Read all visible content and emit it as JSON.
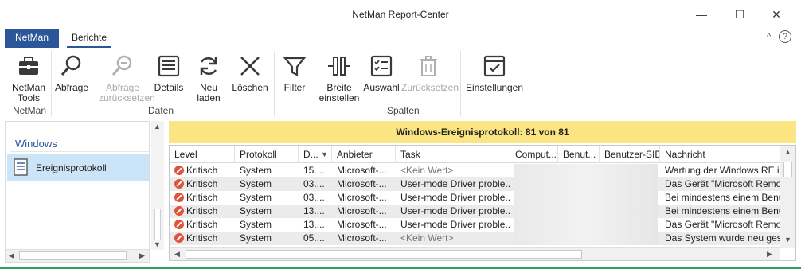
{
  "window": {
    "title": "NetMan Report-Center",
    "minimize": "—",
    "maximize": "☐",
    "close": "✕"
  },
  "tabs": {
    "netman": "NetMan",
    "berichte": "Berichte",
    "collapse": "^",
    "help": "?"
  },
  "ribbon": {
    "netman_tools": "NetMan Tools",
    "abfrage": "Abfrage",
    "abfrage_reset": "Abfrage zurücksetzen",
    "details": "Details",
    "neu_laden": "Neu laden",
    "loeschen": "Löschen",
    "filter": "Filter",
    "breite": "Breite einstellen",
    "auswahl": "Auswahl",
    "zuruecksetzen": "Zurücksetzen",
    "einstellungen": "Einstellungen",
    "groups": {
      "netman": "NetMan",
      "daten": "Daten",
      "spalten": "Spalten"
    }
  },
  "tree": {
    "header": "Windows",
    "item": "Ereignisprotokoll"
  },
  "banner": "Windows-Ereignisprotokoll: 81 von 81",
  "table": {
    "columns": [
      "Level",
      "Protokoll",
      "D...",
      "Anbieter",
      "Task",
      "Comput...",
      "Benut...",
      "Benutzer-SID",
      "Nachricht"
    ],
    "rows": [
      {
        "level": "Kritisch",
        "protokoll": "System",
        "datum": "15....",
        "anbieter": "Microsoft-...",
        "task": "<Kein Wert>",
        "nachricht": "Wartung der Windows RE ist f"
      },
      {
        "level": "Kritisch",
        "protokoll": "System",
        "datum": "03....",
        "anbieter": "Microsoft-...",
        "task": "User-mode Driver proble...",
        "nachricht": "Das Gerät \"Microsoft Remote I"
      },
      {
        "level": "Kritisch",
        "protokoll": "System",
        "datum": "03....",
        "anbieter": "Microsoft-...",
        "task": "User-mode Driver proble...",
        "nachricht": "Bei mindestens einem Benutze"
      },
      {
        "level": "Kritisch",
        "protokoll": "System",
        "datum": "13....",
        "anbieter": "Microsoft-...",
        "task": "User-mode Driver proble...",
        "nachricht": "Bei mindestens einem Benutze"
      },
      {
        "level": "Kritisch",
        "protokoll": "System",
        "datum": "13....",
        "anbieter": "Microsoft-...",
        "task": "User-mode Driver proble...",
        "nachricht": "Das Gerät \"Microsoft Remote I"
      },
      {
        "level": "Kritisch",
        "protokoll": "System",
        "datum": "05....",
        "anbieter": "Microsoft-...",
        "task": "<Kein Wert>",
        "nachricht": "Das System wurde neu gestar"
      }
    ]
  },
  "colors": {
    "accent": "#2b579a",
    "banner": "#fbe582",
    "selection": "#cce4f7",
    "critical": "#e0533b"
  }
}
